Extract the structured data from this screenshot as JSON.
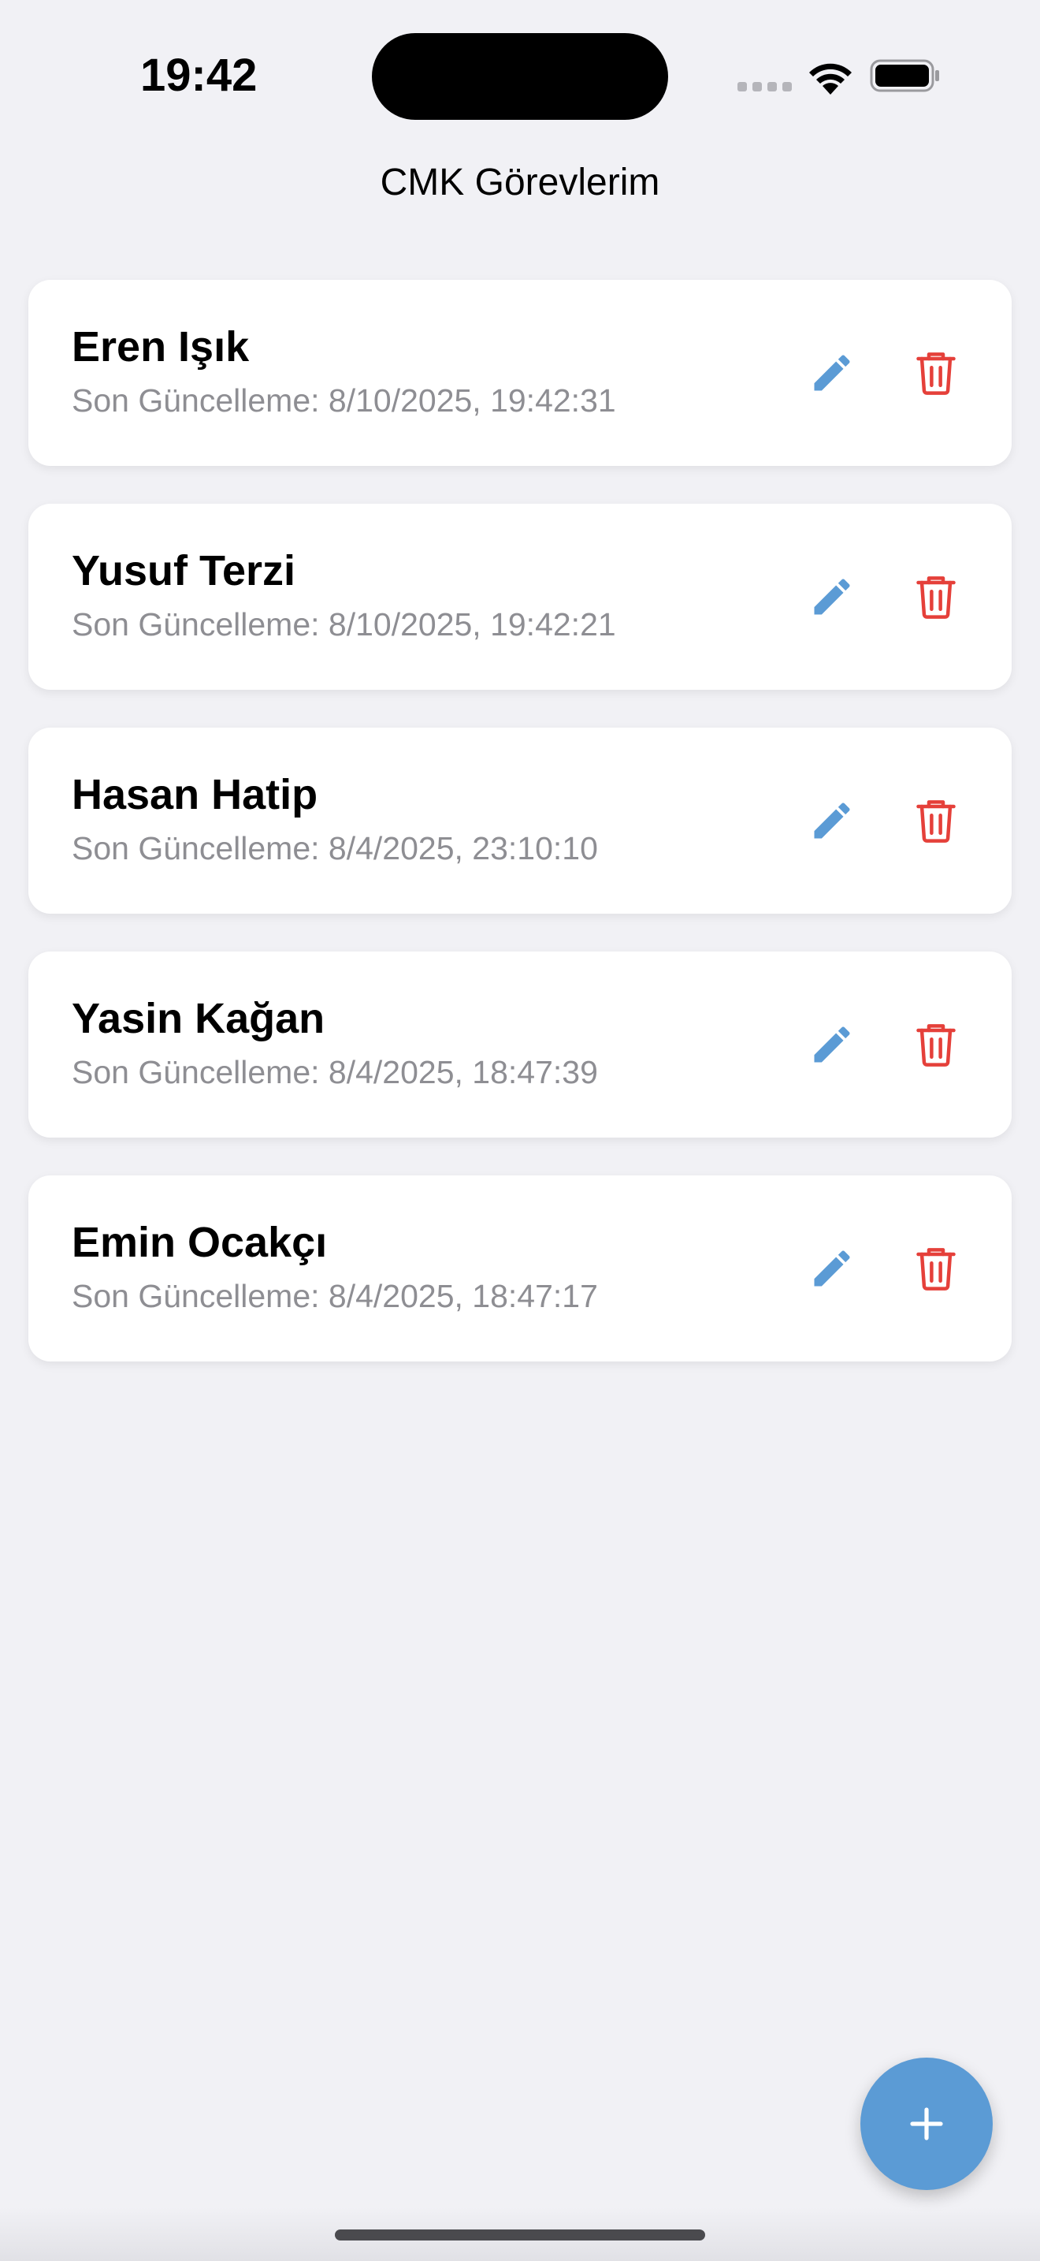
{
  "status_bar": {
    "time": "19:42"
  },
  "header": {
    "title": "CMK Görevlerim"
  },
  "tasks": [
    {
      "name": "Eren Işık",
      "updated": "Son Güncelleme: 8/10/2025, 19:42:31"
    },
    {
      "name": "Yusuf Terzi",
      "updated": "Son Güncelleme: 8/10/2025, 19:42:21"
    },
    {
      "name": "Hasan Hatip",
      "updated": "Son Güncelleme: 8/4/2025, 23:10:10"
    },
    {
      "name": "Yasin Kağan",
      "updated": "Son Güncelleme: 8/4/2025, 18:47:39"
    },
    {
      "name": "Emin Ocakçı",
      "updated": "Son Güncelleme: 8/4/2025, 18:47:17"
    }
  ],
  "icons": {
    "edit": "pencil-icon",
    "delete": "trash-icon",
    "add": "plus-icon"
  },
  "colors": {
    "background": "#f1f1f5",
    "card": "#ffffff",
    "accent": "#5b9bd5",
    "danger": "#e5403a",
    "secondary_text": "#8e8e93"
  }
}
